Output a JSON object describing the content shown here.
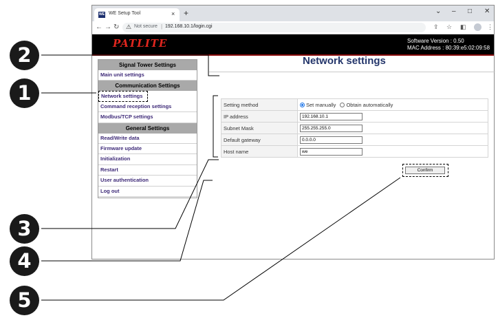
{
  "browser": {
    "tab_title": "WE Setup Tool",
    "favicon_text": "WE",
    "security_label": "Not secure",
    "url": "192.168.10.1/login.cgi"
  },
  "header": {
    "logo": "PATLITE",
    "software_version": "Software Version : 0.50",
    "mac_address": "MAC Address : 80:39:e5:02:09:58"
  },
  "sidebar": {
    "signal_tower_heading": "Signal Tower Settings",
    "main_unit": "Main unit settings",
    "communication_heading": "Communication Settings",
    "network": "Network settings",
    "command_reception": "Command reception settings",
    "modbus": "Modbus/TCP settings",
    "general_heading": "General Settings",
    "read_write": "Read/Write data",
    "firmware": "Firmware update",
    "initialization": "Initialization",
    "restart": "Restart",
    "user_auth": "User authentication",
    "logout": "Log out"
  },
  "main": {
    "title": "Network settings",
    "setting_method_label": "Setting method",
    "set_manually": "Set manually",
    "obtain_automatically": "Obtain automatically",
    "ip_label": "IP address",
    "ip_value": "192.168.10.1",
    "subnet_label": "Subnet Mask",
    "subnet_value": "255.255.255.0",
    "gateway_label": "Default gateway",
    "gateway_value": "0.0.0.0",
    "host_label": "Host name",
    "host_value": "we",
    "confirm": "Confirm"
  },
  "callouts": [
    "2",
    "1",
    "3",
    "4",
    "5"
  ],
  "colors": {
    "title_blue": "#24366b",
    "menu_text": "#3e2a78",
    "logo_red": "#e0261e",
    "header_bg": "#000000",
    "menu_heading_bg": "#a9a9a9"
  }
}
